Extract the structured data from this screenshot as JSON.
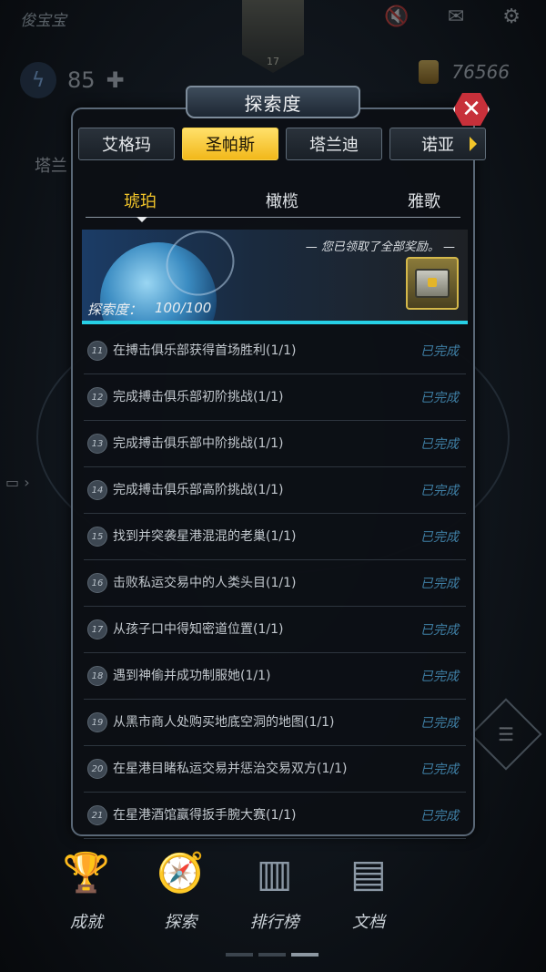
{
  "background": {
    "player_name": "俊宝宝",
    "avatar_level": "17",
    "energy": "85",
    "coins": "76566",
    "coins_partial": "0",
    "side_label": "塔兰",
    "icons": [
      "mute-icon",
      "mail-icon",
      "gear-icon",
      "lightning-icon",
      "plus-icon",
      "chat-icon",
      "task-list-icon"
    ]
  },
  "bottom_nav": [
    {
      "label": "成就",
      "icon": "trophy-icon"
    },
    {
      "label": "探索",
      "icon": "compass-icon"
    },
    {
      "label": "排行榜",
      "icon": "podium-icon"
    },
    {
      "label": "文档",
      "icon": "newspaper-icon"
    }
  ],
  "modal": {
    "title": "探索度",
    "tabs": [
      {
        "label": "艾格玛",
        "active": false
      },
      {
        "label": "圣帕斯",
        "active": true
      },
      {
        "label": "塔兰迪",
        "active": false
      },
      {
        "label": "诺亚",
        "active": false
      }
    ],
    "subtabs": [
      {
        "label": "琥珀",
        "active": true
      },
      {
        "label": "橄榄",
        "active": false
      },
      {
        "label": "雅歌",
        "active": false
      }
    ],
    "banner": {
      "message": "— 您已领取了全部奖励。 —",
      "progress_label": "探索度：",
      "progress_value": "100/100",
      "progress_fraction": 1.0
    },
    "tasks": [
      {
        "num": "11",
        "text": "在搏击俱乐部获得首场胜利(1/1)",
        "status": "已完成"
      },
      {
        "num": "12",
        "text": "完成搏击俱乐部初阶挑战(1/1)",
        "status": "已完成"
      },
      {
        "num": "13",
        "text": "完成搏击俱乐部中阶挑战(1/1)",
        "status": "已完成"
      },
      {
        "num": "14",
        "text": "完成搏击俱乐部高阶挑战(1/1)",
        "status": "已完成"
      },
      {
        "num": "15",
        "text": "找到并突袭星港混混的老巢(1/1)",
        "status": "已完成"
      },
      {
        "num": "16",
        "text": "击败私运交易中的人类头目(1/1)",
        "status": "已完成"
      },
      {
        "num": "17",
        "text": "从孩子口中得知密道位置(1/1)",
        "status": "已完成"
      },
      {
        "num": "18",
        "text": "遇到神偷并成功制服她(1/1)",
        "status": "已完成"
      },
      {
        "num": "19",
        "text": "从黑市商人处购买地底空洞的地图(1/1)",
        "status": "已完成"
      },
      {
        "num": "20",
        "text": "在星港目睹私运交易并惩治交易双方(1/1)",
        "status": "已完成"
      },
      {
        "num": "21",
        "text": "在星港酒馆赢得扳手腕大赛(1/1)",
        "status": "已完成"
      }
    ]
  },
  "colors": {
    "accent_gold": "#f2c52a",
    "progress_cyan": "#27d0e6",
    "status_blue": "#3f7fa5",
    "close_red": "#c7303a"
  }
}
